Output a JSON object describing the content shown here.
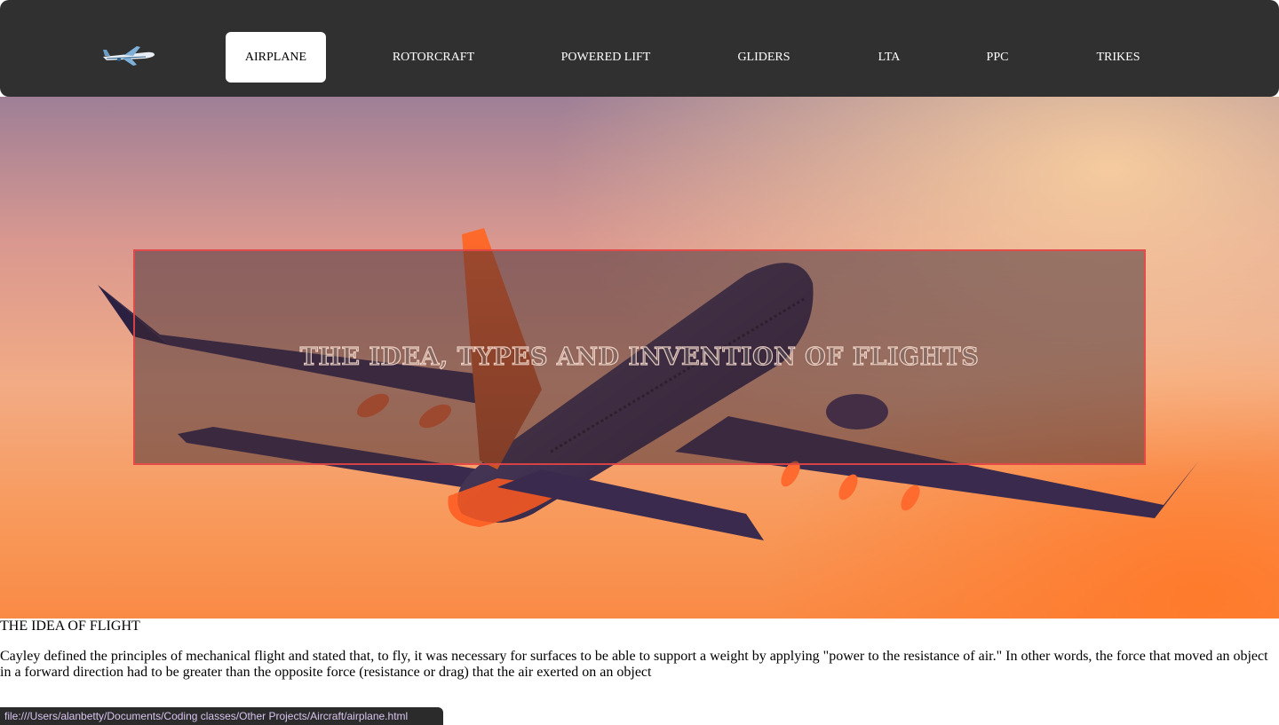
{
  "nav": {
    "logo_icon": "airplane-logo-icon",
    "items": [
      {
        "label": "AIRPLANE",
        "active": true
      },
      {
        "label": "ROTORCRAFT",
        "active": false
      },
      {
        "label": "POWERED LIFT",
        "active": false
      },
      {
        "label": "GLIDERS",
        "active": false
      },
      {
        "label": "LTA",
        "active": false
      },
      {
        "label": "PPC",
        "active": false
      },
      {
        "label": "TRIKES",
        "active": false
      }
    ]
  },
  "hero": {
    "title": "THE IDEA, TYPES AND INVENTION OF FLIGHTS",
    "image": "airplane-sunset-photo"
  },
  "content": {
    "heading": "THE IDEA OF FLIGHT",
    "paragraph": "Cayley defined the principles of mechanical flight and stated that, to fly, it was necessary for surfaces to be able to support a weight by applying \"power to the resistance of air.\" In other words, the force that moved an object in a forward direction had to be greater than the opposite force (resistance or drag) that the air exerted on an object"
  },
  "status_bar": {
    "url": "file:///Users/alanbetty/Documents/Coding classes/Other Projects/Aircraft/airplane.html"
  },
  "colors": {
    "navbar_bg": "#303030",
    "active_tab_bg": "#ffffff",
    "overlay_border": "#f04646"
  }
}
